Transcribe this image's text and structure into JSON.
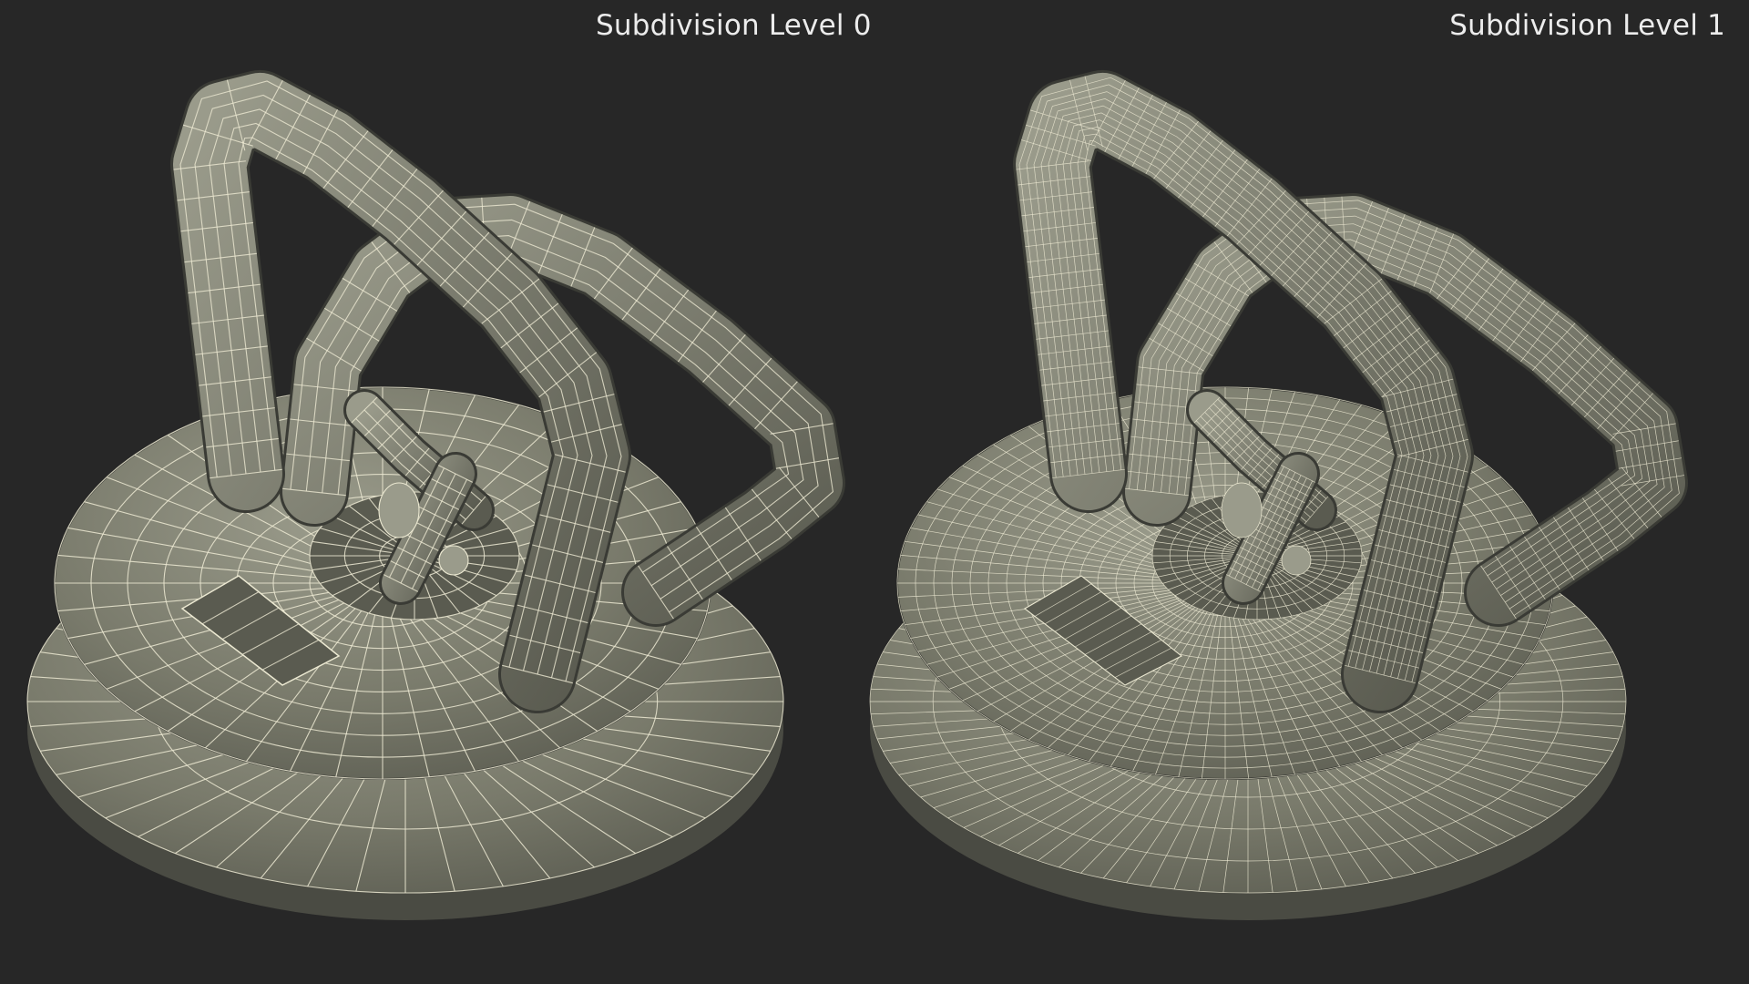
{
  "renders": [
    {
      "label": "Subdivision Level 0",
      "subject": "suction-cup-lifter-wireframe",
      "mesh_density": "low"
    },
    {
      "label": "Subdivision Level 1",
      "subject": "suction-cup-lifter-wireframe",
      "mesh_density": "high"
    }
  ],
  "colors": {
    "background": "#272727",
    "surface": "#797a6b",
    "surface_shadow": "#5a5b50",
    "surface_highlight": "#9a9b8b",
    "wire": "#ece9d2",
    "label_text": "#ececec"
  }
}
